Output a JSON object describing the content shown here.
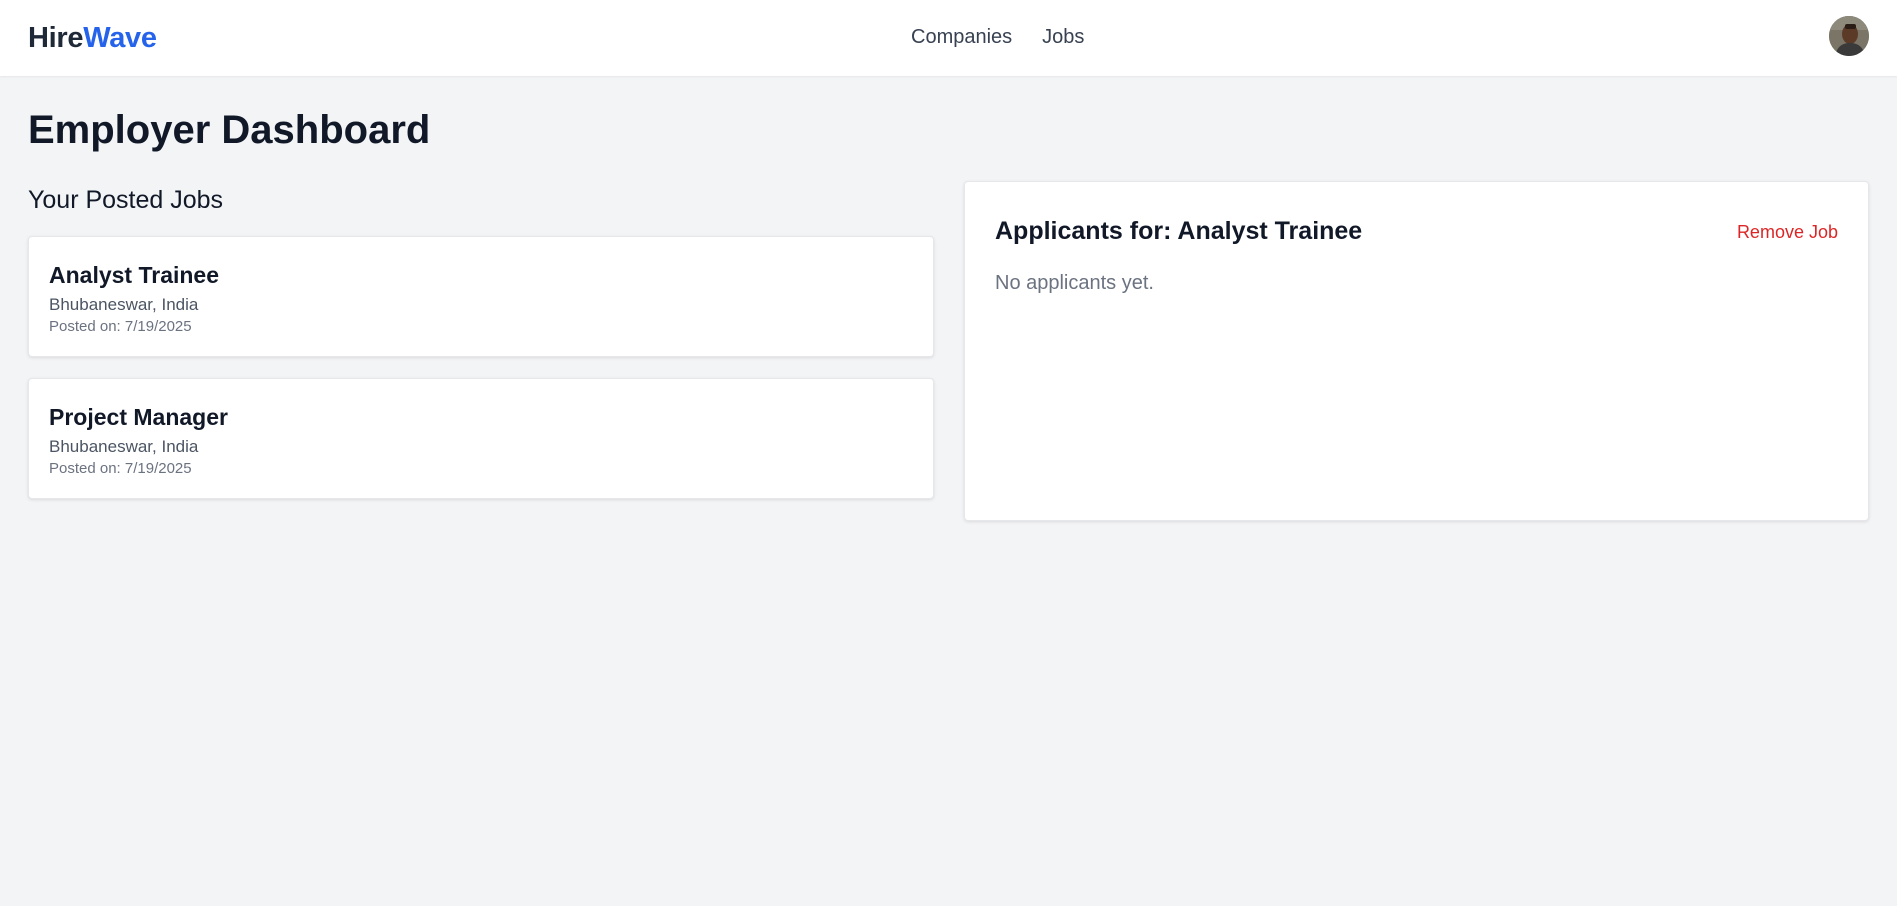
{
  "nav": {
    "logo_part1": "Hire",
    "logo_part2": "Wave",
    "links": [
      "Companies",
      "Jobs"
    ],
    "avatar_icon": "user-avatar-icon"
  },
  "page": {
    "title": "Employer Dashboard",
    "posted_jobs_heading": "Your Posted Jobs"
  },
  "jobs": [
    {
      "title": "Analyst Trainee",
      "location": "Bhubaneswar, India",
      "posted": "Posted on: 7/19/2025"
    },
    {
      "title": "Project Manager",
      "location": "Bhubaneswar, India",
      "posted": "Posted on: 7/19/2025"
    }
  ],
  "applicants_panel": {
    "title": "Applicants for: Analyst Trainee",
    "remove_label": "Remove Job",
    "empty_message": "No applicants yet."
  },
  "colors": {
    "brand_blue": "#2563eb",
    "danger_red": "#dc2626",
    "background": "#f3f4f6"
  }
}
